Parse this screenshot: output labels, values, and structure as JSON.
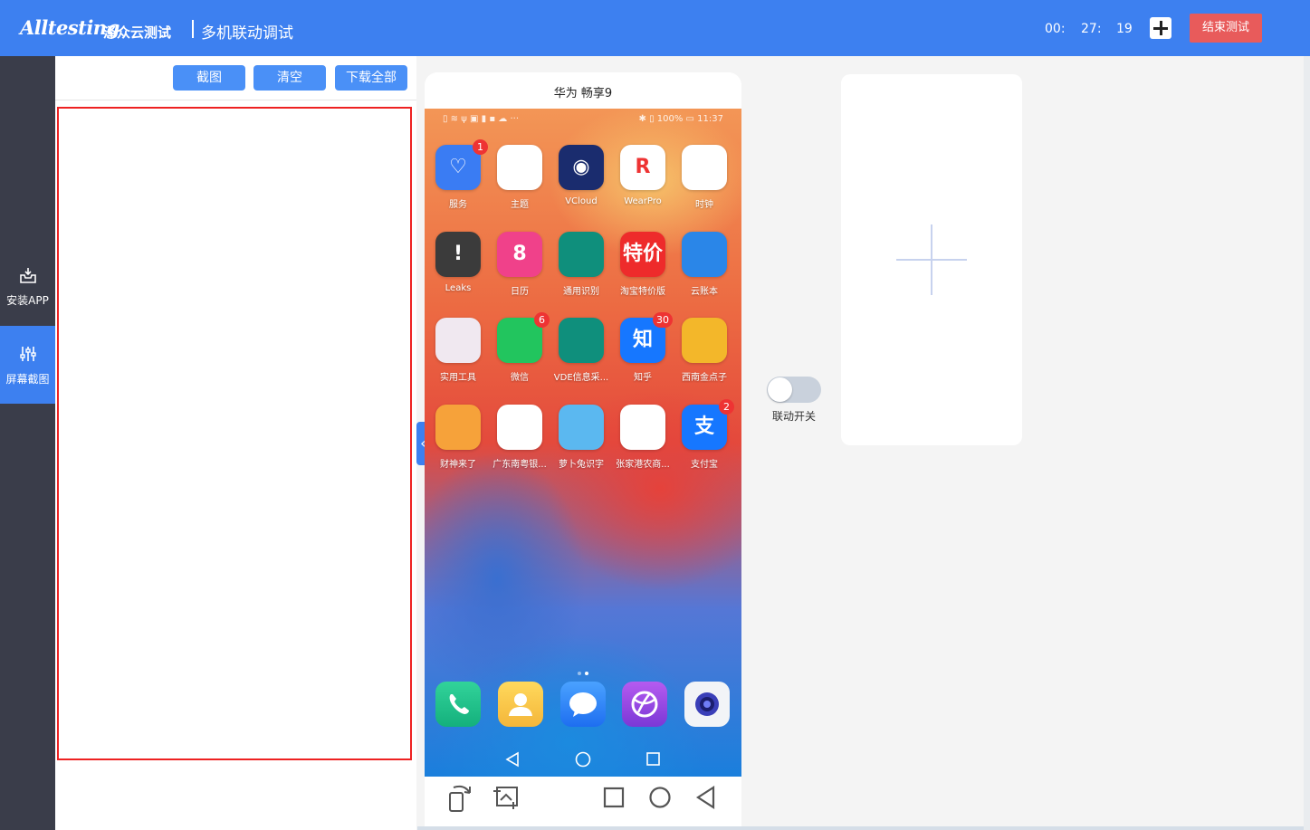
{
  "header": {
    "logo_text": "Alltesting",
    "logo_cn": "泽众云测试",
    "page_title": "多机联动调试",
    "timer": {
      "hours": "00:",
      "minutes": "27:",
      "seconds": "19"
    },
    "end_test_label": "结束测试"
  },
  "sidebar": {
    "items": [
      {
        "label": "安装APP",
        "icon": "inbox-download-icon",
        "active": false
      },
      {
        "label": "屏幕截图",
        "icon": "sliders-icon",
        "active": true
      }
    ]
  },
  "toolbar": {
    "screenshot_label": "截图",
    "clear_label": "清空",
    "download_all_label": "下载全部"
  },
  "device": {
    "name": "华为 畅享9",
    "status_right": "✱ ▯ 100% ▭ 11:37",
    "apps": [
      {
        "label": "服务",
        "badge": "1",
        "bg": "#3a7cf3",
        "glyph": "♡"
      },
      {
        "label": "主题",
        "badge": "",
        "bg": "#ffffff",
        "glyph": ""
      },
      {
        "label": "VCloud",
        "badge": "",
        "bg": "#1a2c6e",
        "glyph": "◉"
      },
      {
        "label": "WearPro",
        "badge": "",
        "bg": "#ffffff",
        "glyph": "R"
      },
      {
        "label": "时钟",
        "badge": "",
        "bg": "#ffffff",
        "glyph": ""
      },
      {
        "label": "Leaks",
        "badge": "",
        "bg": "#3b3b3b",
        "glyph": "!"
      },
      {
        "label": "日历",
        "badge": "",
        "bg": "#f0418a",
        "glyph": "8"
      },
      {
        "label": "通用识别",
        "badge": "",
        "bg": "#0f8f7c",
        "glyph": ""
      },
      {
        "label": "淘宝特价版",
        "badge": "",
        "bg": "#ee2b2b",
        "glyph": "特价"
      },
      {
        "label": "云账本",
        "badge": "",
        "bg": "#2a86e8",
        "glyph": ""
      },
      {
        "label": "实用工具",
        "badge": "",
        "bg": "#f0e8f0",
        "glyph": ""
      },
      {
        "label": "微信",
        "badge": "6",
        "bg": "#22c55e",
        "glyph": ""
      },
      {
        "label": "VDE信息采...",
        "badge": "",
        "bg": "#0f8f7c",
        "glyph": ""
      },
      {
        "label": "知乎",
        "badge": "30",
        "bg": "#1677ff",
        "glyph": "知"
      },
      {
        "label": "西南金点子",
        "badge": "",
        "bg": "#f3b72a",
        "glyph": ""
      },
      {
        "label": "财神来了",
        "badge": "",
        "bg": "#f6a23a",
        "glyph": ""
      },
      {
        "label": "广东南粤银...",
        "badge": "",
        "bg": "#ffffff",
        "glyph": ""
      },
      {
        "label": "萝卜兔识字",
        "badge": "",
        "bg": "#5bb8f0",
        "glyph": ""
      },
      {
        "label": "张家港农商...",
        "badge": "",
        "bg": "#ffffff",
        "glyph": ""
      },
      {
        "label": "支付宝",
        "badge": "2",
        "bg": "#1677ff",
        "glyph": "支"
      }
    ]
  },
  "link_toggle": {
    "label": "联动开关",
    "on": false
  },
  "colors": {
    "accent": "#3d80f0",
    "danger": "#e85b5b",
    "sidebar": "#3a3d4a",
    "highlight_border": "#ee2222"
  }
}
